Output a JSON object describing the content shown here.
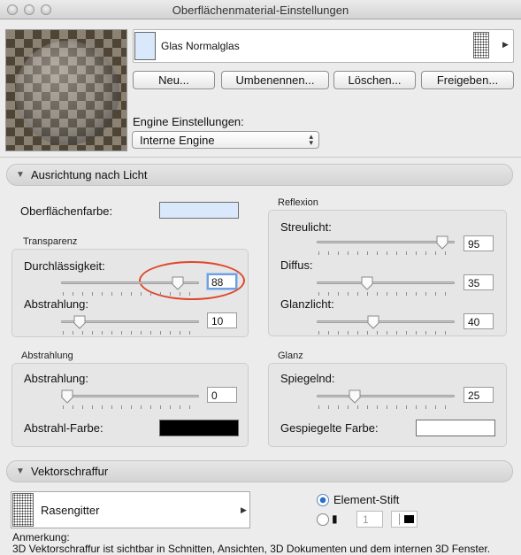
{
  "window": {
    "title": "Oberflächenmaterial-Einstellungen"
  },
  "material": {
    "name": "Glas Normalglas",
    "swatch_color": "#d9e9fb"
  },
  "buttons": {
    "new": "Neu...",
    "rename": "Umbenennen...",
    "delete": "Löschen...",
    "share": "Freigeben..."
  },
  "engine": {
    "label": "Engine Einstellungen:",
    "value": "Interne Engine"
  },
  "sections": {
    "light": "Ausrichtung nach Licht",
    "hatch": "Vektorschraffur"
  },
  "surface": {
    "label": "Oberflächenfarbe:",
    "color": "#d9e9fb"
  },
  "transparency": {
    "title": "Transparenz",
    "permeability": {
      "label": "Durchlässigkeit:",
      "value": "88",
      "level": 0.88
    },
    "radiation": {
      "label": "Abstrahlung:",
      "value": "10",
      "level": 0.1
    }
  },
  "reflection": {
    "title": "Reflexion",
    "ambient": {
      "label": "Streulicht:",
      "value": "95",
      "level": 0.95
    },
    "diffuse": {
      "label": "Diffus:",
      "value": "35",
      "level": 0.35
    },
    "specular": {
      "label": "Glanzlicht:",
      "value": "40",
      "level": 0.4
    }
  },
  "emission": {
    "title": "Abstrahlung",
    "amount": {
      "label": "Abstrahlung:",
      "value": "0",
      "level": 0.0
    },
    "color_label": "Abstrahl-Farbe:",
    "color": "#000000"
  },
  "shine": {
    "title": "Glanz",
    "mirror": {
      "label": "Spiegelnd:",
      "value": "25",
      "level": 0.25
    },
    "color_label": "Gespiegelte Farbe:",
    "color": "#ffffff"
  },
  "hatch": {
    "pattern": "Rasengitter",
    "pen_option": "Element-Stift",
    "pen_number": "1"
  },
  "note": {
    "label": "Anmerkung:",
    "text": "3D Vektorschraffur ist sichtbar in Schnitten, Ansichten, 3D Dokumenten und dem internen 3D Fenster."
  },
  "colors": {
    "highlight": "#e0462c",
    "focus": "#6fa0df"
  }
}
